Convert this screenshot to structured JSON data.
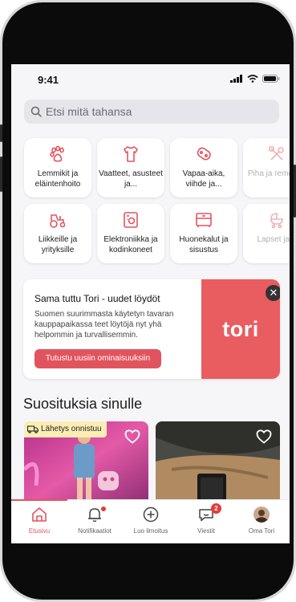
{
  "status_bar": {
    "time": "9:41"
  },
  "search": {
    "placeholder": "Etsi mitä tahansa"
  },
  "categories": [
    {
      "label": "Lemmikit ja eläintenhoito",
      "icon": "paw-icon"
    },
    {
      "label": "Vaatteet, asusteet ja...",
      "icon": "shirt-icon"
    },
    {
      "label": "Vapaa-aika, viihde ja...",
      "icon": "gamepad-icon"
    },
    {
      "label": "Piha ja remontoi",
      "icon": "tools-icon"
    },
    {
      "label": "Liikkeille ja yrityksille",
      "icon": "tractor-icon"
    },
    {
      "label": "Elektroniikka ja kodinkoneet",
      "icon": "appliance-icon"
    },
    {
      "label": "Huonekalut ja sisustus",
      "icon": "furniture-icon"
    },
    {
      "label": "Lapset ja ä",
      "icon": "stroller-icon"
    }
  ],
  "promo": {
    "title": "Sama tuttu Tori - uudet löydöt",
    "text": "Suomen suurimmasta käytetyn tavaran kauppapaikassa teet löytöjä nyt yhä helpommin ja turvallisemmin.",
    "button": "Tutustu uusiin ominaisuuksiin",
    "brand": "tori",
    "close": "✕"
  },
  "recommendations": {
    "title": "Suosituksia sinulle",
    "cards": [
      {
        "badge": "Lähetys onnistuu"
      },
      {
        "badge": ""
      }
    ]
  },
  "tabbar": {
    "items": [
      {
        "label": "Etusivu",
        "icon": "home-icon"
      },
      {
        "label": "Notifikaatiot",
        "icon": "bell-icon"
      },
      {
        "label": "Luo ilmoitus",
        "icon": "plus-circle-icon"
      },
      {
        "label": "Viestit",
        "icon": "chat-icon",
        "badge": "2"
      },
      {
        "label": "Oma Tori",
        "icon": "avatar"
      }
    ]
  },
  "colors": {
    "accent": "#e2545d",
    "brand": "#e95c60"
  }
}
